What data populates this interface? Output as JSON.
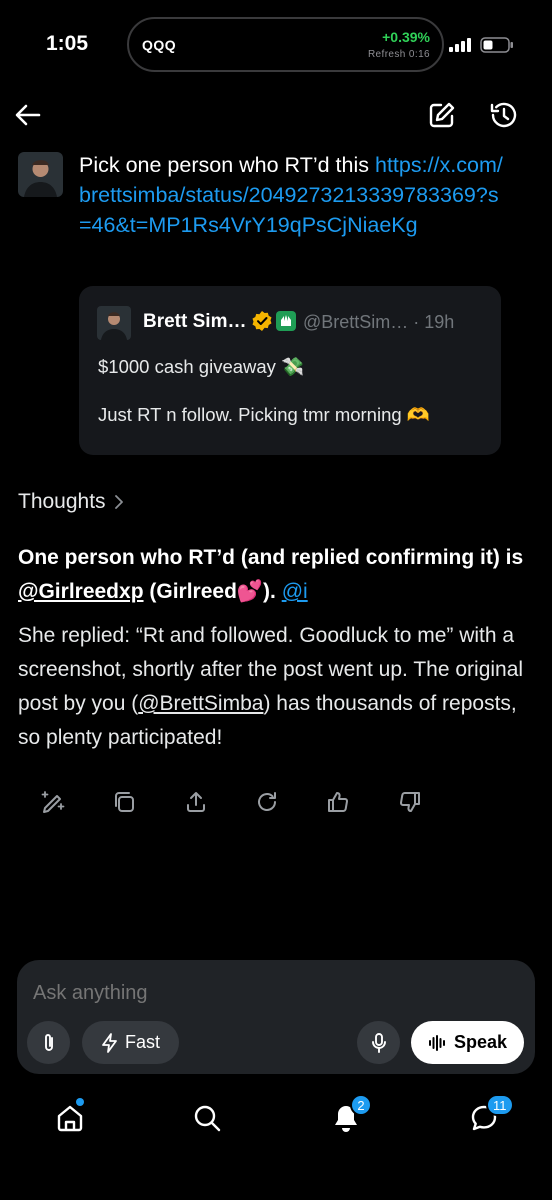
{
  "status_bar": {
    "time": "1:05",
    "ticker": "QQQ",
    "change": "+0.39%",
    "refresh": "Refresh 0:16"
  },
  "message": {
    "prompt_text": "Pick one person who RT’d this ",
    "prompt_link": "https://x.com/brettsimba/status/2049273213339783369?s=46&t=MP1Rs4VrY19qPsCjNiaeKg"
  },
  "quote": {
    "name": "Brett Sim…",
    "handle": "@BrettSim… · 19h",
    "line1": "$1000 cash giveaway 💸",
    "line2": "Just RT n follow. Picking tmr morning 🫶"
  },
  "thoughts_label": "Thoughts",
  "answer": {
    "lead": "One person who RT’d (and replied confirming it) is ",
    "mention": "@Girlreedxp",
    "paren": " (Girlreed💕). ",
    "tail_mention": "@i",
    "body_1": "She replied: “Rt and followed. Goodluck to me” with a screenshot, shortly after the post went up. The original post by you (",
    "body_mention": "@BrettSimba",
    "body_2": ") has thousands of reposts, so plenty participated!"
  },
  "composer": {
    "placeholder": "Ask anything",
    "fast_label": "Fast",
    "speak_label": "Speak"
  },
  "tabs": {
    "notifications_count": "2",
    "messages_count": "11"
  },
  "colors": {
    "accent": "#1d9bf0",
    "positive": "#30d158",
    "verified": "#f4b400",
    "org": "#1f9d55"
  }
}
